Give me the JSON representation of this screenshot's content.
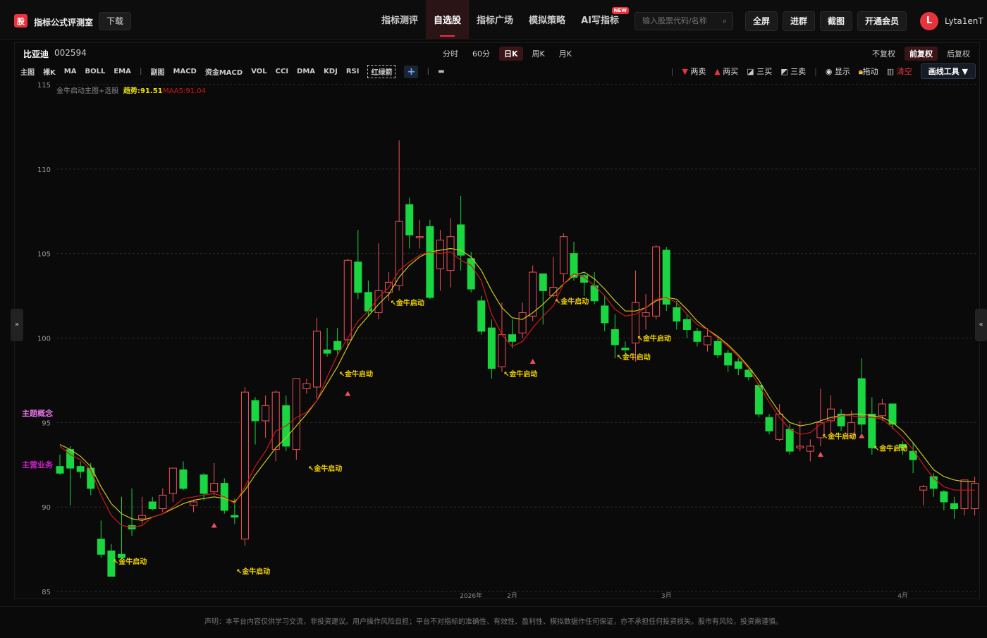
{
  "header": {
    "logo_char": "股",
    "brand": "指标公式评测室",
    "download": "下载",
    "nav": [
      "指标测评",
      "自选股",
      "指标广场",
      "模拟策略",
      "AI写指标"
    ],
    "nav_active": 1,
    "new_badge": "NEW",
    "search_placeholder": "输入股票代码/名称",
    "buttons": [
      "全屏",
      "进群",
      "截图",
      "开通会员"
    ],
    "avatar": "L",
    "username": "Lyta1enT"
  },
  "stock": {
    "name": "比亚迪",
    "code": "002594"
  },
  "periods": [
    "分时",
    "60分",
    "日K",
    "周K",
    "月K"
  ],
  "period_active": 2,
  "adjust": [
    "不复权",
    "前复权",
    "后复权"
  ],
  "adjust_active": 1,
  "indicators_main": [
    "主图",
    "裸K",
    "MA",
    "BOLL",
    "EMA"
  ],
  "indicators_sub": [
    "副图",
    "MACD",
    "资金MACD",
    "VOL",
    "CCI",
    "DMA",
    "KDJ",
    "RSI"
  ],
  "indicator_dashed": "红绿箭",
  "tools": {
    "two_sell": "两卖",
    "two_buy": "两买",
    "three_buy": "三买",
    "three_sell": "三卖",
    "show": "显示",
    "drag": "拖动",
    "clear": "清空",
    "draw": "画线工具 ▼"
  },
  "legend": {
    "name": "金牛启动主图+选股",
    "trend": "趋势:91.51",
    "maa": "MAA5:91.04"
  },
  "side_labels": {
    "theme": "主题概念",
    "business": "主营业务"
  },
  "footer": "声明：本平台内容仅供学习交流，非投资建议。用户操作风险自担；平台不对指标的准确性、有效性、盈利性、模拟数据作任何保证，亦不承担任何投资损失。股市有风险，投资需谨慎。",
  "colors": {
    "up": "#f0505a",
    "down": "#19d641",
    "trend": "#c8c820",
    "maa": "#d01818",
    "signal": "#f0d000",
    "accent": "#e8323c"
  },
  "chart_data": {
    "type": "candlestick",
    "ylim": [
      85,
      115
    ],
    "yticks": [
      85,
      90,
      95,
      100,
      105,
      110,
      115
    ],
    "xlabels": [
      {
        "i": 40,
        "t": "2026年"
      },
      {
        "i": 44,
        "t": "2月"
      },
      {
        "i": 59,
        "t": "3月"
      },
      {
        "i": 82,
        "t": "4月"
      }
    ],
    "candles": [
      [
        92.4,
        93.1,
        92.0,
        91.9
      ],
      [
        93.4,
        93.6,
        92.3,
        90.1
      ],
      [
        92.4,
        92.7,
        92.1,
        91.7
      ],
      [
        92.3,
        92.6,
        91.1,
        90.7
      ],
      [
        88.1,
        89.2,
        87.2,
        87.0
      ],
      [
        87.4,
        87.8,
        85.9,
        86.2
      ],
      [
        87.2,
        90.6,
        87.0,
        86.9
      ],
      [
        88.9,
        91.1,
        88.7,
        88.3
      ],
      [
        89.3,
        90.6,
        89.5,
        89.0
      ],
      [
        90.3,
        90.6,
        89.9,
        89.8
      ],
      [
        89.9,
        91.1,
        90.7,
        89.7
      ],
      [
        90.8,
        92.2,
        92.3,
        90.3
      ],
      [
        92.2,
        92.7,
        91.1,
        91.0
      ],
      [
        90.1,
        90.4,
        90.3,
        89.7
      ],
      [
        91.9,
        92.0,
        90.8,
        90.4
      ],
      [
        90.9,
        92.6,
        91.4,
        90.7
      ],
      [
        91.4,
        91.7,
        89.8,
        89.6
      ],
      [
        89.5,
        90.5,
        89.4,
        89.0
      ],
      [
        88.1,
        97.1,
        96.8,
        87.7
      ],
      [
        96.3,
        96.5,
        95.1,
        93.7
      ],
      [
        95.1,
        96.6,
        96.0,
        94.1
      ],
      [
        93.4,
        96.9,
        96.8,
        92.7
      ],
      [
        96.0,
        96.6,
        93.6,
        93.3
      ],
      [
        93.4,
        96.9,
        97.6,
        92.8
      ],
      [
        97.0,
        97.6,
        97.3,
        96.7
      ],
      [
        97.1,
        101.2,
        100.4,
        96.4
      ],
      [
        99.3,
        100.6,
        99.1,
        98.9
      ],
      [
        99.8,
        100.6,
        99.3,
        99.0
      ],
      [
        99.9,
        104.7,
        104.6,
        99.4
      ],
      [
        104.5,
        106.4,
        102.7,
        102.3
      ],
      [
        102.7,
        103.4,
        101.6,
        101.3
      ],
      [
        101.5,
        105.6,
        102.8,
        101.1
      ],
      [
        102.7,
        103.9,
        103.3,
        102.2
      ],
      [
        103.1,
        111.7,
        106.9,
        102.8
      ],
      [
        107.9,
        108.3,
        106.1,
        105.3
      ],
      [
        106.0,
        107.0,
        106.0,
        105.3
      ],
      [
        106.6,
        107.0,
        102.4,
        102.3
      ],
      [
        104.1,
        106.4,
        105.8,
        102.8
      ],
      [
        104.0,
        107.1,
        106.0,
        103.0
      ],
      [
        106.7,
        108.4,
        104.9,
        104.0
      ],
      [
        104.7,
        105.1,
        102.9,
        102.7
      ],
      [
        102.2,
        102.5,
        100.4,
        100.2
      ],
      [
        100.6,
        101.1,
        98.2,
        97.6
      ],
      [
        98.3,
        102.1,
        100.2,
        98.0
      ],
      [
        100.2,
        101.1,
        99.8,
        99.4
      ],
      [
        100.3,
        102.1,
        101.5,
        100.0
      ],
      [
        101.3,
        104.3,
        103.9,
        101.0
      ],
      [
        103.8,
        103.8,
        102.8,
        100.8
      ],
      [
        102.5,
        104.8,
        103.0,
        102.4
      ],
      [
        103.8,
        106.2,
        106.0,
        103.3
      ],
      [
        105.0,
        105.7,
        103.6,
        103.4
      ],
      [
        103.7,
        103.8,
        103.3,
        102.5
      ],
      [
        103.1,
        103.9,
        102.2,
        102.0
      ],
      [
        101.9,
        102.5,
        100.9,
        100.4
      ],
      [
        100.5,
        101.4,
        99.6,
        98.8
      ],
      [
        99.4,
        99.8,
        99.3,
        99.0
      ],
      [
        99.7,
        104.0,
        102.1,
        98.6
      ],
      [
        101.3,
        102.6,
        101.5,
        100.5
      ],
      [
        101.3,
        105.5,
        105.4,
        101.1
      ],
      [
        105.2,
        105.4,
        102.0,
        101.6
      ],
      [
        101.8,
        102.2,
        101.0,
        100.5
      ],
      [
        101.1,
        101.4,
        100.5,
        100.0
      ],
      [
        100.4,
        100.6,
        99.8,
        99.5
      ],
      [
        99.6,
        100.6,
        100.1,
        99.2
      ],
      [
        99.8,
        100.1,
        99.0,
        98.8
      ],
      [
        99.1,
        99.3,
        98.4,
        98.0
      ],
      [
        98.6,
        98.8,
        98.2,
        97.8
      ],
      [
        98.1,
        98.2,
        97.7,
        97.5
      ],
      [
        97.2,
        97.3,
        95.5,
        95.3
      ],
      [
        95.3,
        95.5,
        94.5,
        94.3
      ],
      [
        94.0,
        96.1,
        95.5,
        93.9
      ],
      [
        94.6,
        94.9,
        93.3,
        93.1
      ],
      [
        93.5,
        95.1,
        93.6,
        93.3
      ],
      [
        93.3,
        94.0,
        93.6,
        92.7
      ],
      [
        94.1,
        97.0,
        95.0,
        93.6
      ],
      [
        95.1,
        96.6,
        95.8,
        94.3
      ],
      [
        95.5,
        95.8,
        94.8,
        94.5
      ],
      [
        94.2,
        95.7,
        95.0,
        94.1
      ],
      [
        97.6,
        98.8,
        94.9,
        94.4
      ],
      [
        95.5,
        96.5,
        93.5,
        93.1
      ],
      [
        95.4,
        96.4,
        96.1,
        95.1
      ],
      [
        96.1,
        96.1,
        94.9,
        94.6
      ],
      [
        93.7,
        93.9,
        93.5,
        93.1
      ],
      [
        93.3,
        93.8,
        92.8,
        92.0
      ],
      [
        91.0,
        91.3,
        91.2,
        90.1
      ],
      [
        91.8,
        92.0,
        91.1,
        90.6
      ],
      [
        90.9,
        91.0,
        90.3,
        89.8
      ],
      [
        90.2,
        90.6,
        89.9,
        89.3
      ],
      [
        89.9,
        91.6,
        91.6,
        89.5
      ],
      [
        89.9,
        91.8,
        91.4,
        89.5
      ]
    ],
    "trend": [
      93.7,
      93.4,
      93.0,
      92.4,
      91.2,
      90.2,
      89.6,
      89.3,
      89.2,
      89.4,
      89.6,
      89.9,
      90.2,
      90.4,
      90.5,
      90.6,
      90.5,
      90.3,
      91.0,
      91.9,
      92.7,
      93.5,
      94.1,
      94.8,
      95.5,
      96.3,
      97.3,
      98.3,
      99.5,
      100.6,
      101.3,
      102.0,
      102.6,
      103.6,
      104.3,
      104.8,
      105.1,
      105.2,
      105.3,
      105.2,
      104.8,
      104.0,
      102.8,
      101.8,
      101.2,
      101.1,
      101.5,
      102.0,
      102.6,
      103.2,
      103.7,
      103.9,
      103.5,
      102.9,
      102.2,
      101.6,
      101.6,
      101.8,
      102.2,
      102.4,
      102.3,
      101.7,
      101.0,
      100.5,
      100.1,
      99.6,
      99.0,
      98.3,
      97.5,
      96.5,
      95.6,
      95.0,
      94.8,
      94.9,
      95.1,
      95.3,
      95.4,
      95.5,
      95.5,
      95.4,
      95.3,
      95.0,
      94.5,
      93.8,
      93.0,
      92.2,
      91.8,
      91.6,
      91.5,
      91.5
    ],
    "maa5": [
      93.6,
      93.1,
      92.8,
      92.2,
      90.7,
      89.5,
      88.9,
      88.8,
      88.9,
      89.4,
      89.6,
      90.0,
      90.5,
      90.6,
      90.7,
      90.8,
      90.6,
      90.2,
      91.2,
      92.4,
      93.3,
      94.5,
      94.8,
      95.3,
      95.6,
      96.3,
      97.7,
      99.0,
      100.0,
      101.0,
      101.6,
      102.4,
      103.0,
      104.0,
      104.5,
      104.9,
      105.1,
      105.0,
      105.1,
      104.6,
      104.3,
      103.4,
      101.4,
      100.2,
      99.5,
      99.8,
      100.6,
      101.3,
      101.9,
      103.2,
      103.8,
      103.6,
      103.1,
      102.5,
      101.7,
      101.3,
      101.4,
      101.8,
      102.3,
      102.4,
      102.1,
      101.4,
      100.8,
      100.5,
      100.0,
      99.5,
      98.9,
      98.2,
      97.2,
      96.2,
      95.3,
      94.6,
      94.3,
      94.4,
      94.9,
      95.2,
      95.4,
      95.4,
      95.3,
      95.3,
      95.2,
      94.7,
      94.1,
      93.4,
      92.5,
      91.7,
      91.2,
      91.0,
      91.0,
      91.0
    ],
    "signals": [
      {
        "i": 5,
        "price": 86.8,
        "label": "↖金牛启动"
      },
      {
        "i": 17,
        "price": 86.2,
        "label": "↖金牛启动"
      },
      {
        "i": 24,
        "price": 92.3,
        "label": "↖金牛启动"
      },
      {
        "i": 27,
        "price": 97.9,
        "label": "↖金牛启动"
      },
      {
        "i": 32,
        "price": 102.1,
        "label": "↖金牛启动"
      },
      {
        "i": 43,
        "price": 97.9,
        "label": "↖金牛启动"
      },
      {
        "i": 48,
        "price": 102.2,
        "label": "↖金牛启动"
      },
      {
        "i": 54,
        "price": 98.9,
        "label": "↖金牛启动"
      },
      {
        "i": 56,
        "price": 100.0,
        "label": "↖金牛启动"
      },
      {
        "i": 74,
        "price": 94.2,
        "label": "↖金牛启动"
      },
      {
        "i": 79,
        "price": 93.5,
        "label": "↖金牛启动"
      }
    ],
    "triangles": [
      {
        "i": 15,
        "price": 88.9
      },
      {
        "i": 28,
        "price": 96.7
      },
      {
        "i": 46,
        "price": 98.6
      },
      {
        "i": 74,
        "price": 93.1
      },
      {
        "i": 78,
        "price": 94.2
      }
    ]
  }
}
